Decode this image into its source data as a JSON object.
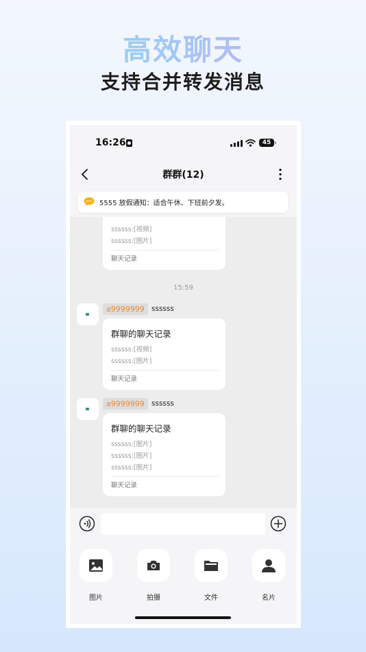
{
  "promo": {
    "title": "高效聊天",
    "subtitle": "支持合并转发消息"
  },
  "status_bar": {
    "time": "16:26",
    "battery": "45"
  },
  "nav": {
    "title": "群群(12)"
  },
  "notice": {
    "text": "5555 放假通知：适合午休、下班前夕发。"
  },
  "messages": {
    "partial": {
      "lines": [
        "ssssss:[视频]",
        "ssssss:[图片]"
      ],
      "footer": "聊天记录"
    },
    "timestamp": "15:59",
    "items": [
      {
        "sender": "a9999999",
        "text": "ssssss",
        "card_title": "群聊的聊天记录",
        "lines": [
          "ssssss:[视频]",
          "ssssss:[图片]"
        ],
        "footer": "聊天记录"
      },
      {
        "sender": "a9999999",
        "text": "ssssss",
        "card_title": "群聊的聊天记录",
        "lines": [
          "ssssss:[图片]",
          "ssssss:[图片]",
          "ssssss:[图片]"
        ],
        "footer": "聊天记录"
      }
    ]
  },
  "input": {
    "value": ""
  },
  "tools": [
    {
      "label": "图片",
      "icon": "image-icon"
    },
    {
      "label": "拍摄",
      "icon": "camera-icon"
    },
    {
      "label": "文件",
      "icon": "folder-icon"
    },
    {
      "label": "名片",
      "icon": "contact-card-icon"
    }
  ]
}
